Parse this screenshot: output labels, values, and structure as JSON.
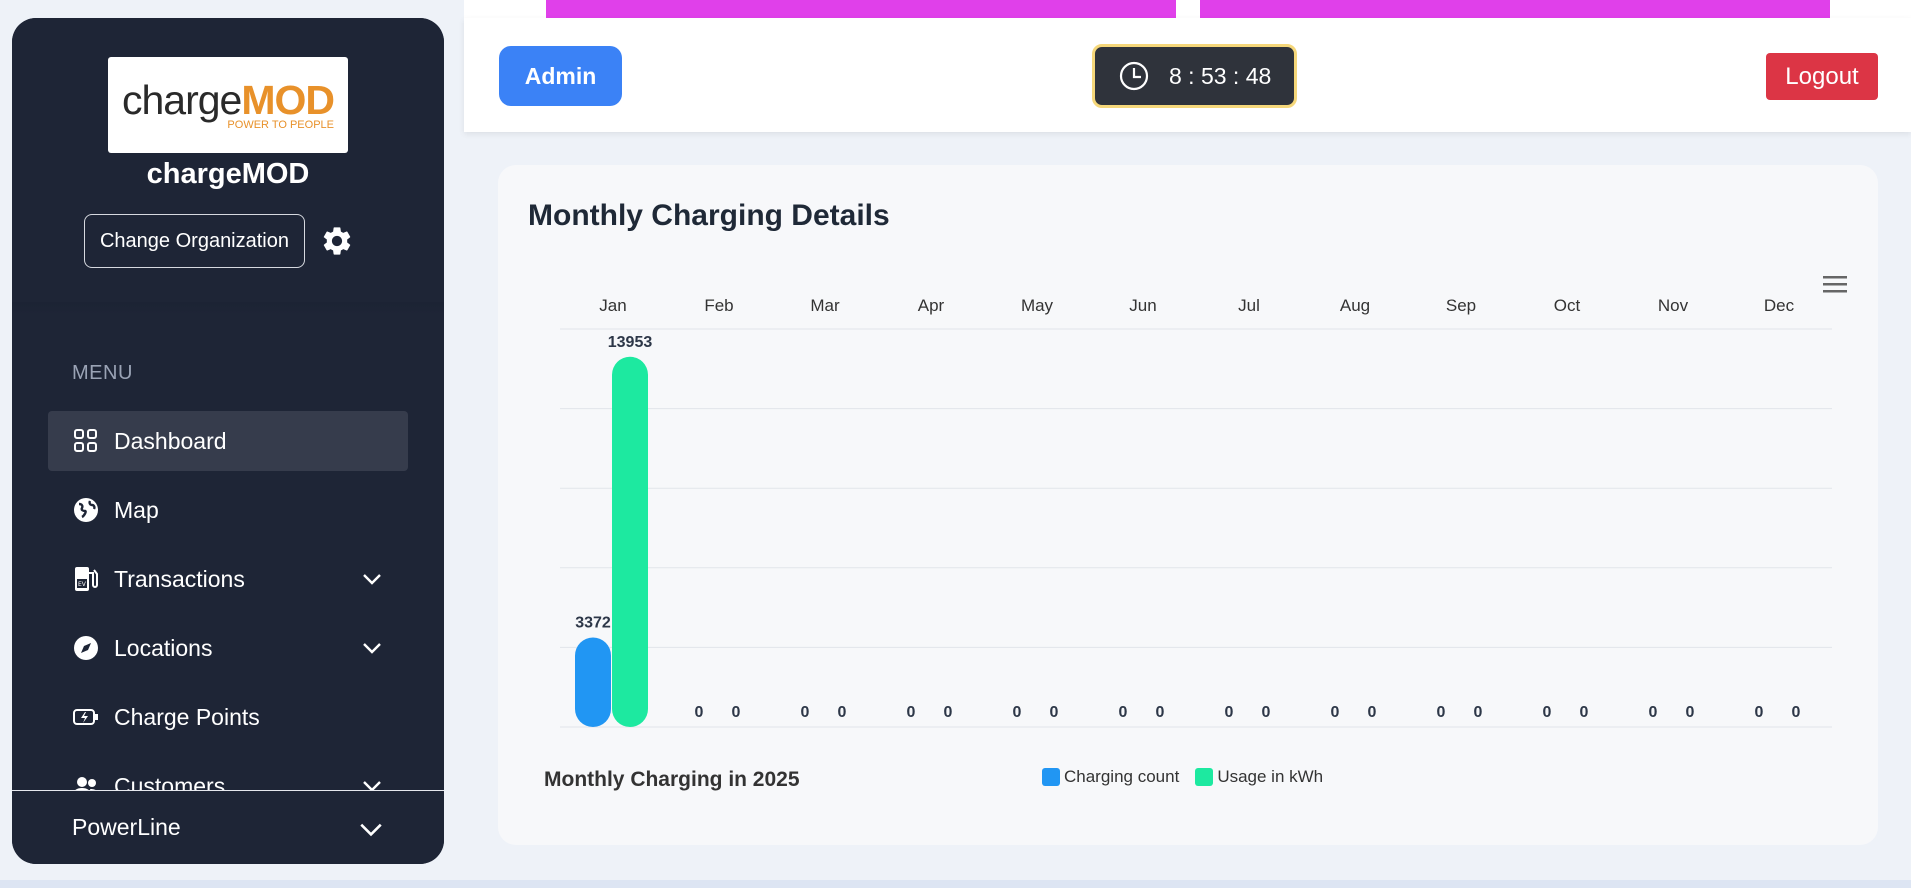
{
  "sidebar": {
    "logo": {
      "word_plain": "charge",
      "word_bold": "MOD",
      "tagline": "POWER TO PEOPLE"
    },
    "org_name": "chargeMOD",
    "change_org_label": "Change Organization",
    "menu_label": "MENU",
    "items": [
      {
        "label": "Dashboard",
        "icon": "grid-icon",
        "active": true,
        "has_children": false
      },
      {
        "label": "Map",
        "icon": "globe-icon",
        "active": false,
        "has_children": false
      },
      {
        "label": "Transactions",
        "icon": "ev-pump-icon",
        "active": false,
        "has_children": true
      },
      {
        "label": "Locations",
        "icon": "compass-icon",
        "active": false,
        "has_children": true
      },
      {
        "label": "Charge Points",
        "icon": "battery-charging-icon",
        "active": false,
        "has_children": false
      },
      {
        "label": "Customers",
        "icon": "users-icon",
        "active": false,
        "has_children": true
      }
    ],
    "footer_label": "PowerLine"
  },
  "header": {
    "admin_label": "Admin",
    "clock_time": "8 : 53 : 48",
    "logout_label": "Logout"
  },
  "chart_card": {
    "title": "Monthly Charging Details"
  },
  "colors": {
    "sidebar_bg": "#1e2536",
    "accent_blue": "#3b82f6",
    "logout_red": "#dc3545",
    "bar_count": "#2196f3",
    "bar_usage": "#1de9a0",
    "magenta": "#e040ea",
    "clock_border": "#f5d77a"
  },
  "chart_data": {
    "type": "bar",
    "title": "Monthly Charging in 2025",
    "categories": [
      "Jan",
      "Feb",
      "Mar",
      "Apr",
      "May",
      "Jun",
      "Jul",
      "Aug",
      "Sep",
      "Oct",
      "Nov",
      "Dec"
    ],
    "series": [
      {
        "name": "Charging count",
        "color": "#2196f3",
        "values": [
          3372,
          0,
          0,
          0,
          0,
          0,
          0,
          0,
          0,
          0,
          0,
          0
        ]
      },
      {
        "name": "Usage in kWh",
        "color": "#1de9a0",
        "values": [
          13953,
          0,
          0,
          0,
          0,
          0,
          0,
          0,
          0,
          0,
          0,
          0
        ]
      }
    ],
    "ylim": [
      0,
      15000
    ],
    "grid": true,
    "x_axis_position": "top",
    "legend_position": "bottom-center",
    "data_labels": true
  }
}
